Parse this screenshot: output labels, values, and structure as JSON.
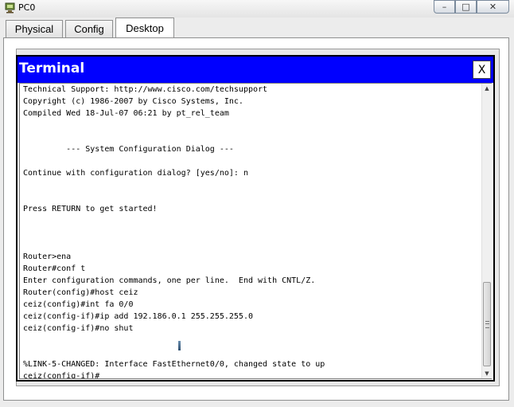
{
  "window": {
    "title": "PC0",
    "minimize_glyph": "–",
    "maximize_glyph": "□",
    "close_glyph": "✕"
  },
  "tabs": [
    {
      "label": "Physical",
      "active": false
    },
    {
      "label": "Config",
      "active": false
    },
    {
      "label": "Desktop",
      "active": true
    }
  ],
  "terminal": {
    "title": "Terminal",
    "close_label": "X",
    "lines": [
      "Technical Support: http://www.cisco.com/techsupport",
      "Copyright (c) 1986-2007 by Cisco Systems, Inc.",
      "Compiled Wed 18-Jul-07 06:21 by pt_rel_team",
      "",
      "",
      "         --- System Configuration Dialog ---",
      "",
      "Continue with configuration dialog? [yes/no]: n",
      "",
      "",
      "Press RETURN to get started!",
      "",
      "",
      "",
      "Router>ena",
      "Router#conf t",
      "Enter configuration commands, one per line.  End with CNTL/Z.",
      "Router(config)#host ceiz",
      "ceiz(config)#int fa 0/0",
      "ceiz(config-if)#ip add 192.186.0.1 255.255.255.0",
      "ceiz(config-if)#no shut",
      "",
      "",
      "%LINK-5-CHANGED: Interface FastEthernet0/0, changed state to up",
      "ceiz(config-if)#"
    ]
  },
  "icons": {
    "app": "packet-tracer-pc-icon",
    "scroll_up": "arrow-up-icon",
    "scroll_down": "arrow-down-icon"
  },
  "colors": {
    "terminal_titlebar": "#0000ff",
    "terminal_title_text": "#ffffff"
  }
}
